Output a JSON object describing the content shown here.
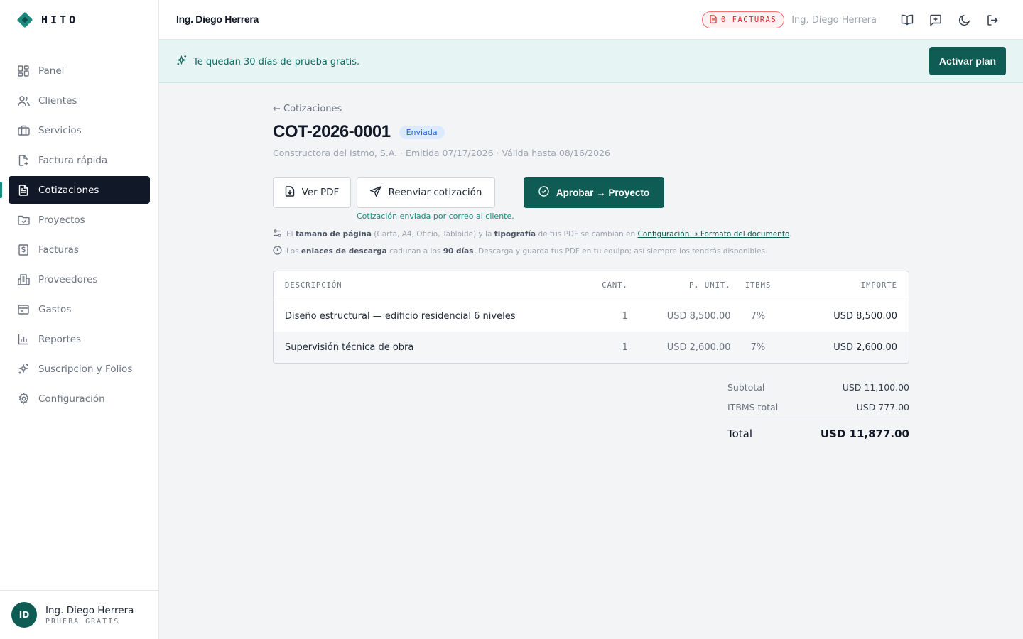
{
  "brand": {
    "name": "HITO"
  },
  "sidebar": {
    "items": [
      {
        "label": "Panel",
        "icon": "grid-icon"
      },
      {
        "label": "Clientes",
        "icon": "users-icon"
      },
      {
        "label": "Servicios",
        "icon": "briefcase-icon"
      },
      {
        "label": "Factura rápida",
        "icon": "file-plus-icon"
      },
      {
        "label": "Cotizaciones",
        "icon": "file-text-icon",
        "active": true
      },
      {
        "label": "Proyectos",
        "icon": "folder-icon"
      },
      {
        "label": "Facturas",
        "icon": "dollar-file-icon"
      },
      {
        "label": "Proveedores",
        "icon": "building-icon"
      },
      {
        "label": "Gastos",
        "icon": "inbox-icon"
      },
      {
        "label": "Reportes",
        "icon": "bar-chart-icon"
      },
      {
        "label": "Suscripcion y Folios",
        "icon": "sparkles-icon"
      },
      {
        "label": "Configuración",
        "icon": "gear-icon"
      }
    ],
    "user": {
      "initials": "ID",
      "name": "Ing. Diego Herrera",
      "plan": "PRUEBA GRATIS"
    }
  },
  "topbar": {
    "title": "Ing. Diego Herrera",
    "invoices_badge": "0 FACTURAS",
    "user_name": "Ing. Diego Herrera"
  },
  "banner": {
    "text": "Te quedan 30 días de prueba gratis.",
    "button": "Activar plan"
  },
  "quote": {
    "back_label": "← Cotizaciones",
    "number": "COT-2026-0001",
    "status": "Enviada",
    "meta": "Constructora del Istmo, S.A. · Emitida 07/17/2026 · Válida hasta 08/16/2026",
    "actions": {
      "view_pdf": "Ver PDF",
      "resend": "Reenviar cotización",
      "approve": "Aprobar → Proyecto"
    },
    "sent_note": "Cotización enviada por correo al cliente.",
    "info1": {
      "p1": "El",
      "b1": "tamaño de página",
      "p2": "(Carta, A4, Oficio, Tabloide) y la",
      "b2": "tipografía",
      "p3": "de tus PDF se cambian en",
      "link": "Configuración → Formato del documento",
      "p4": "."
    },
    "info2": {
      "p1": "Los",
      "b1": "enlaces de descarga",
      "p2": "caducan a los",
      "b2": "90 días",
      "p3": ". Descarga y guarda tus PDF en tu equipo; así siempre los tendrás disponibles."
    },
    "table": {
      "headers": {
        "desc": "DESCRIPCIÓN",
        "qty": "CANT.",
        "unit": "P. UNIT.",
        "tax": "ITBMS",
        "amount": "IMPORTE"
      },
      "rows": [
        {
          "desc": "Diseño estructural — edificio residencial 6 niveles",
          "qty": "1",
          "unit": "USD 8,500.00",
          "tax": "7%",
          "amount": "USD 8,500.00"
        },
        {
          "desc": "Supervisión técnica de obra",
          "qty": "1",
          "unit": "USD 2,600.00",
          "tax": "7%",
          "amount": "USD 2,600.00"
        }
      ]
    },
    "totals": {
      "subtotal_label": "Subtotal",
      "subtotal": "USD 11,100.00",
      "tax_label": "ITBMS total",
      "tax": "USD 777.00",
      "total_label": "Total",
      "total": "USD 11,877.00"
    }
  },
  "colors": {
    "accent": "#0f5c55",
    "teal": "#1d8a80",
    "danger": "#dc2626",
    "status_blue": "#2563eb"
  }
}
